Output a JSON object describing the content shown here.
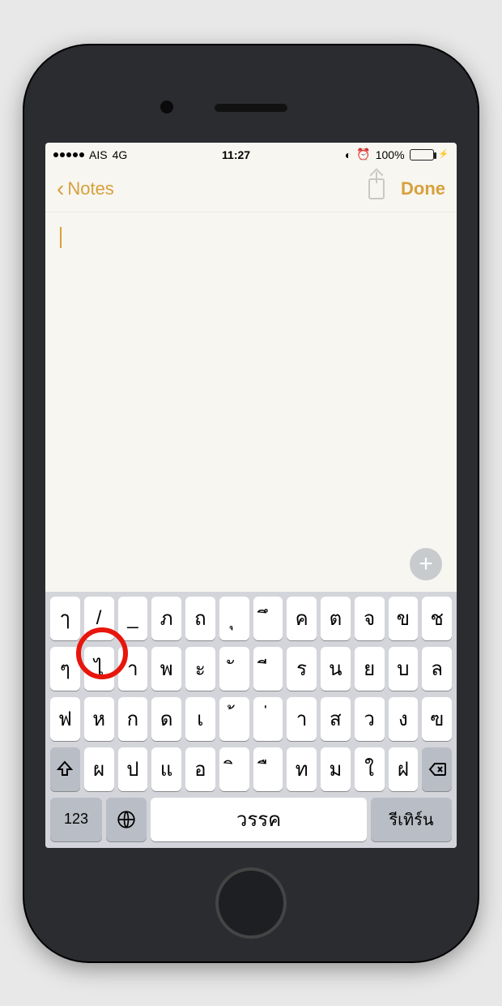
{
  "status": {
    "carrier": "AIS",
    "network": "4G",
    "time": "11:27",
    "battery_pct": "100%"
  },
  "nav": {
    "back_label": "Notes",
    "done_label": "Done"
  },
  "note": {
    "content": ""
  },
  "keyboard": {
    "row1": [
      "ๅ",
      "/",
      "_",
      "ภ",
      "ถ",
      "ุ",
      "ึ",
      "ค",
      "ต",
      "จ",
      "ข",
      "ช"
    ],
    "row2": [
      "ๆ",
      "ไ",
      "ำ",
      "พ",
      "ะ",
      "ั",
      "ี",
      "ร",
      "น",
      "ย",
      "บ",
      "ล"
    ],
    "row3": [
      "ฟ",
      "ห",
      "ก",
      "ด",
      "เ",
      "้",
      "่",
      "า",
      "ส",
      "ว",
      "ง",
      "ฃ"
    ],
    "row4": [
      "ผ",
      "ป",
      "แ",
      "อ",
      "ิ",
      "ื",
      "ท",
      "ม",
      "ใ",
      "ฝ"
    ],
    "k123": "123",
    "space": "วรรค",
    "return": "รีเทิร์น"
  },
  "annotation": {
    "circled_key_index": "row2_1"
  }
}
